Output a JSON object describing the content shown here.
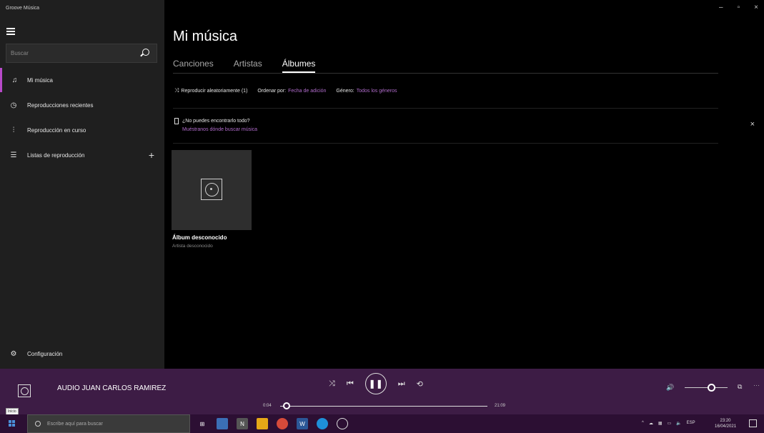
{
  "app": {
    "title": "Groove Música"
  },
  "sidebar": {
    "search_placeholder": "Buscar",
    "items": [
      {
        "label": "Mi música",
        "icon": "music-note-icon"
      },
      {
        "label": "Reproducciones recientes",
        "icon": "clock-icon"
      },
      {
        "label": "Reproducción en curso",
        "icon": "equalizer-icon"
      },
      {
        "label": "Listas de reproducción",
        "icon": "playlist-icon"
      }
    ],
    "add_playlist": "+",
    "settings_label": "Configuración"
  },
  "window": {
    "minimize": "–",
    "maximize": "▫",
    "close": "×"
  },
  "main": {
    "title": "Mi música",
    "tabs": [
      "Canciones",
      "Artistas",
      "Álbumes"
    ],
    "active_tab": 2,
    "toolbar": {
      "shuffle_label": "Reproducir aleatoriamente (1)",
      "sort_label": "Ordenar por:",
      "sort_value": "Fecha de adición",
      "genre_label": "Género:",
      "genre_value": "Todos los géneros"
    },
    "notice": {
      "title": "¿No puedes encontrarlo todo?",
      "link": "Muéstranos dónde buscar música",
      "close": "×"
    },
    "albums": [
      {
        "name": "Álbum desconocido",
        "artist": "Artista desconocido"
      }
    ]
  },
  "player": {
    "track_title": "AUDIO JUAN CARLOS RAMIREZ",
    "current_time": "0:04",
    "total_time": "21:09",
    "progress": 0.003,
    "volume": 0.55,
    "tooltip": "Inicio"
  },
  "taskbar": {
    "search_placeholder": "Escribe aquí para buscar",
    "tray_lang": "ESP",
    "time": "23:20",
    "date": "16/04/2021"
  },
  "colors": {
    "accent": "#b06ccb",
    "player_bg": "#3d1c45",
    "taskbar_bg": "#2c0f33",
    "sidebar_bg": "#1f1f1f"
  }
}
